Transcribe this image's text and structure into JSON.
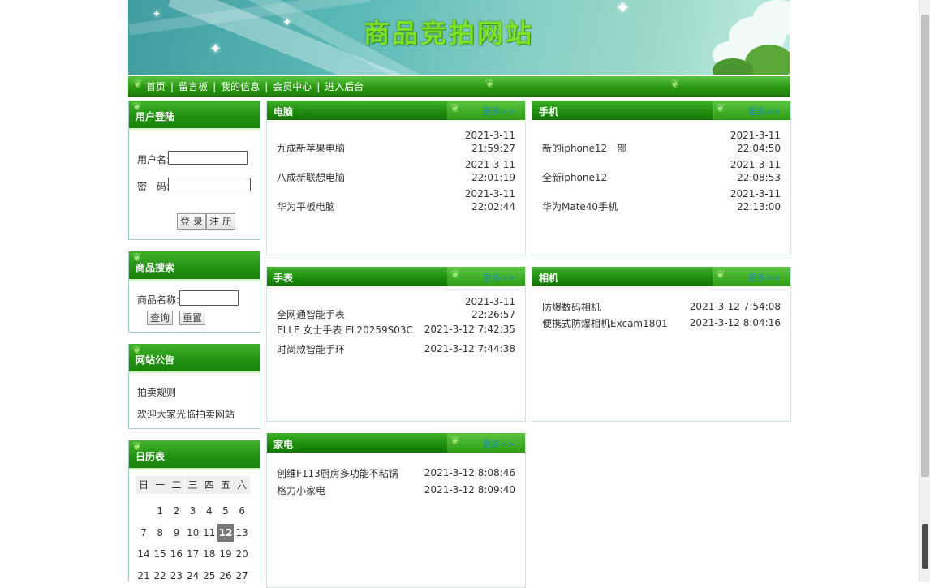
{
  "header": {
    "title": "商品竞拍网站"
  },
  "nav": {
    "items": [
      "首页",
      "留言板",
      "我的信息",
      "会员中心",
      "进入后台"
    ],
    "separator": "|"
  },
  "login": {
    "title": "用户登陆",
    "username_label": "用户名:",
    "password_label": "密　码:",
    "login_button": "登 录",
    "register_button": "注 册"
  },
  "search": {
    "title": "商品搜索",
    "name_label": "商品名称:",
    "query_button": "查询",
    "reset_button": "重置"
  },
  "announcement": {
    "title": "网站公告",
    "items": [
      "拍卖规则",
      "欢迎大家光临拍卖网站"
    ]
  },
  "calendar": {
    "title": "日历表",
    "weekdays": [
      "日",
      "一",
      "二",
      "三",
      "四",
      "五",
      "六"
    ],
    "rows": [
      [
        "",
        "1",
        "2",
        "3",
        "4",
        "5",
        "6"
      ],
      [
        "7",
        "8",
        "9",
        "10",
        "11",
        "12",
        "13"
      ],
      [
        "14",
        "15",
        "16",
        "17",
        "18",
        "19",
        "20"
      ],
      [
        "21",
        "22",
        "23",
        "24",
        "25",
        "26",
        "27"
      ]
    ],
    "today": "12"
  },
  "more_label": "更多>>",
  "categories": [
    {
      "title": "电脑",
      "items": [
        {
          "name": "九成新苹果电脑",
          "date": "2021-3-11",
          "time": "21:59:27"
        },
        {
          "name": "八成新联想电脑",
          "date": "2021-3-11",
          "time": "22:01:19"
        },
        {
          "name": "华为平板电脑",
          "date": "2021-3-11",
          "time": "22:02:44"
        }
      ]
    },
    {
      "title": "手机",
      "items": [
        {
          "name": "新的iphone12一部",
          "date": "2021-3-11",
          "time": "22:04:50"
        },
        {
          "name": "全新iphone12",
          "date": "2021-3-11",
          "time": "22:08:53"
        },
        {
          "name": "华为Mate40手机",
          "date": "2021-3-11",
          "time": "22:13:00"
        }
      ]
    },
    {
      "title": "手表",
      "items": [
        {
          "name": "全网通智能手表",
          "date": "2021-3-11",
          "time": "22:26:57"
        },
        {
          "name": "ELLE 女士手表 EL20259S03C",
          "date": "2021-3-12",
          "time": "7:42:35"
        },
        {
          "name": "时尚款智能手环",
          "date": "2021-3-12",
          "time": "7:44:38"
        }
      ]
    },
    {
      "title": "相机",
      "items": [
        {
          "name": "防爆数码相机",
          "date": "2021-3-12",
          "time": "7:54:08"
        },
        {
          "name": "便携式防爆相机Excam1801",
          "date": "2021-3-12",
          "time": "8:04:16"
        }
      ]
    },
    {
      "title": "家电",
      "items": [
        {
          "name": "创维F113厨房多功能不粘锅",
          "date": "2021-3-12",
          "time": "8:08:46"
        },
        {
          "name": "格力小家电",
          "date": "2021-3-12",
          "time": "8:09:40"
        }
      ]
    }
  ]
}
